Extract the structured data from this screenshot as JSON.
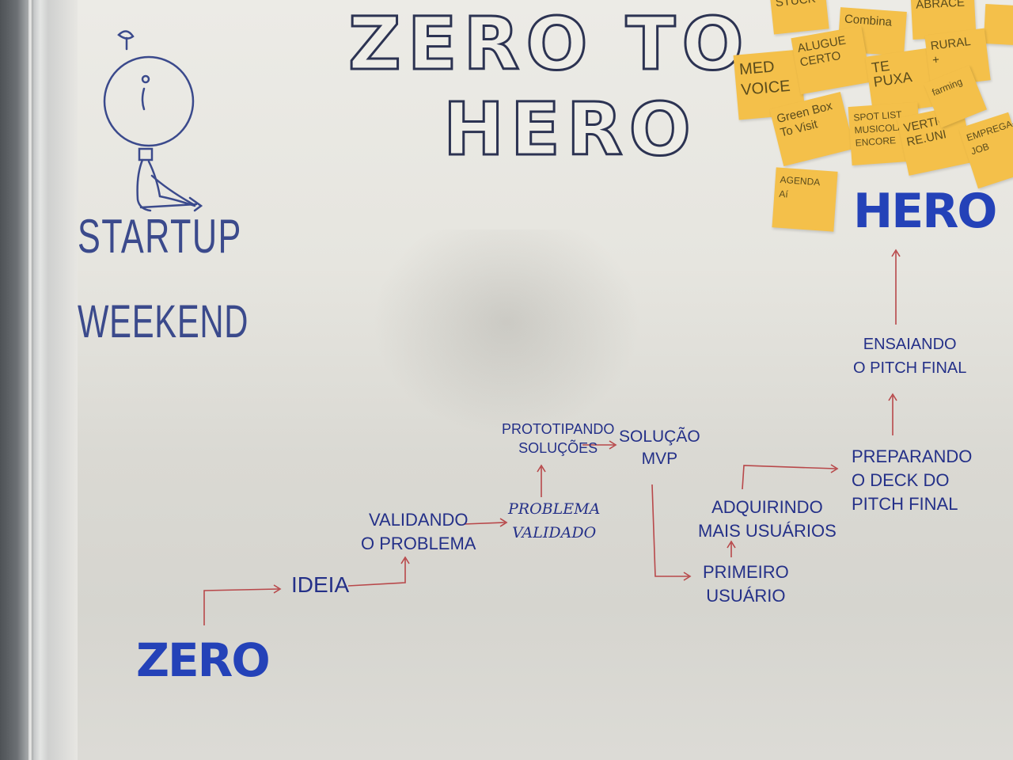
{
  "title": {
    "line1": "ZERO TO",
    "line2": "HERO"
  },
  "logo": {
    "line1": "STARTUP",
    "line2": "WEEKEND"
  },
  "flow": {
    "start": "ZERO",
    "steps": [
      "IDEIA",
      "VALIDANDO\nO PROBLEMA",
      "PROBLEMA\nVALIDADO",
      "PROTOTIPANDO\nSOLUÇÕES",
      "SOLUÇÃO\nMVP",
      "PRIMEIRO\nUSUÁRIO",
      "ADQUIRINDO\nMAIS USUÁRIOS",
      "PREPARANDO\nO DECK DO\nPITCH FINAL",
      "ENSAIANDO\nO PITCH FINAL"
    ],
    "end": "HERO"
  },
  "sticky_notes": [
    "STUCK",
    "Combina",
    "ABRACE",
    "MED\nVOICE",
    "ALUGUE\nCERTO",
    "TE\nPUXA",
    "RURAL\n+",
    "Green Box\nTo Visit",
    "SPOT LIST\nMUSICOLAB\nENCORE",
    "VERTICE\nRE.UNI",
    "EMPREGA-\nJOB",
    "farming",
    "AGENDA\nAí"
  ],
  "colors": {
    "board": "#e8e7e1",
    "ink_blue": "#243088",
    "marker_blue": "#2442b8",
    "arrow_red": "#b8484a",
    "sticky_yellow": "#f4c04a"
  }
}
